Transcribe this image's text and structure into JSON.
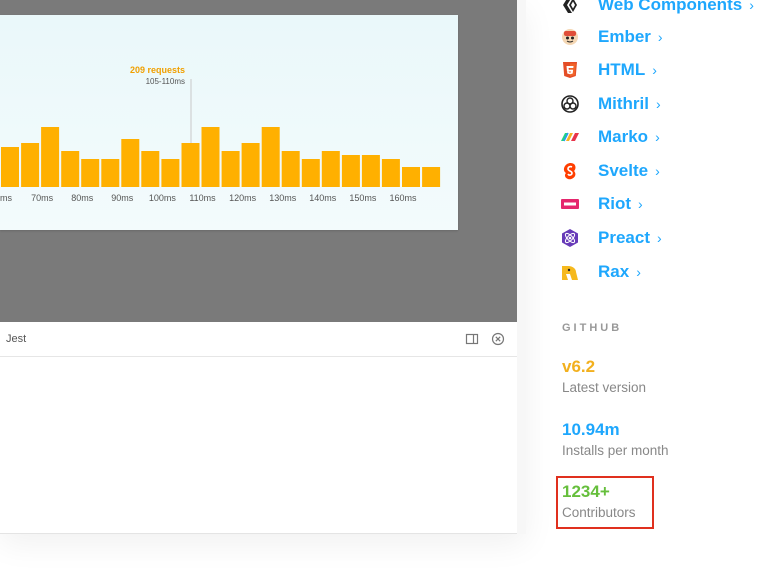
{
  "chart": {
    "tooltip_title": "209 requests",
    "tooltip_range": "105-110ms",
    "highlight_color": "#ffb000"
  },
  "chart_data": {
    "type": "bar",
    "title": "",
    "xlabel": "",
    "ylabel": "",
    "tick_labels": [
      "ms",
      "70ms",
      "80ms",
      "90ms",
      "100ms",
      "110ms",
      "120ms",
      "130ms",
      "140ms",
      "150ms",
      "160ms"
    ],
    "values": [
      10,
      11,
      15,
      9,
      7,
      7,
      12,
      9,
      7,
      11,
      15,
      9,
      11,
      15,
      9,
      7,
      9,
      8,
      8,
      7,
      5,
      5
    ],
    "ylim": [
      0,
      18
    ],
    "bar_color": "#ffb000",
    "annotation": "209 requests 105-110ms",
    "grid": false
  },
  "addons": {
    "tab_label": "Jest"
  },
  "frameworks": [
    {
      "label": "Web Components",
      "icon": "web-components-icon"
    },
    {
      "label": "Ember",
      "icon": "ember-icon"
    },
    {
      "label": "HTML",
      "icon": "html5-icon"
    },
    {
      "label": "Mithril",
      "icon": "mithril-icon"
    },
    {
      "label": "Marko",
      "icon": "marko-icon"
    },
    {
      "label": "Svelte",
      "icon": "svelte-icon"
    },
    {
      "label": "Riot",
      "icon": "riot-icon"
    },
    {
      "label": "Preact",
      "icon": "preact-icon"
    },
    {
      "label": "Rax",
      "icon": "rax-icon"
    }
  ],
  "chevron": "›",
  "github": {
    "heading": "GITHUB",
    "stats": [
      {
        "value": "v6.2",
        "caption": "Latest version",
        "color": "#f2b01e"
      },
      {
        "value": "10.94m",
        "caption": "Installs per month",
        "color": "#1ea7fd"
      },
      {
        "value": "1234+",
        "caption": "Contributors",
        "color": "#66bf3c"
      }
    ]
  },
  "colors": {
    "accent": "#1ea7fd",
    "highlight": "#e0301e"
  }
}
